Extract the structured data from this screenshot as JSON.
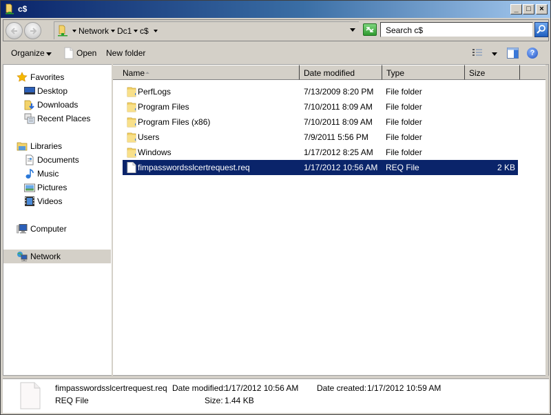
{
  "window": {
    "title": "c$",
    "controls": {
      "minimize": "_",
      "maximize": "□",
      "close": "×"
    }
  },
  "nav": {
    "back_icon": "arrow-left-icon",
    "forward_icon": "arrow-right-icon",
    "breadcrumb": [
      "Network",
      "Dc1",
      "c$"
    ],
    "search_placeholder": "Search c$"
  },
  "toolbar": {
    "organize_label": "Organize",
    "open_label": "Open",
    "new_folder_label": "New folder"
  },
  "sidebar": {
    "groups": [
      {
        "label": "Favorites",
        "icon": "star-icon",
        "items": [
          {
            "label": "Desktop",
            "icon": "desktop-icon"
          },
          {
            "label": "Downloads",
            "icon": "downloads-icon"
          },
          {
            "label": "Recent Places",
            "icon": "recent-places-icon"
          }
        ]
      },
      {
        "label": "Libraries",
        "icon": "libraries-icon",
        "items": [
          {
            "label": "Documents",
            "icon": "documents-icon"
          },
          {
            "label": "Music",
            "icon": "music-icon"
          },
          {
            "label": "Pictures",
            "icon": "pictures-icon"
          },
          {
            "label": "Videos",
            "icon": "videos-icon"
          }
        ]
      },
      {
        "label": "Computer",
        "icon": "computer-icon",
        "items": []
      },
      {
        "label": "Network",
        "icon": "network-icon",
        "items": [],
        "selected": true
      }
    ]
  },
  "filelist": {
    "columns": [
      "Name",
      "Date modified",
      "Type",
      "Size"
    ],
    "rows": [
      {
        "name": "PerfLogs",
        "date": "7/13/2009 8:20 PM",
        "type": "File folder",
        "size": "",
        "icon": "folder-icon"
      },
      {
        "name": "Program Files",
        "date": "7/10/2011 8:09 AM",
        "type": "File folder",
        "size": "",
        "icon": "folder-icon"
      },
      {
        "name": "Program Files (x86)",
        "date": "7/10/2011 8:09 AM",
        "type": "File folder",
        "size": "",
        "icon": "folder-icon"
      },
      {
        "name": "Users",
        "date": "7/9/2011 5:56 PM",
        "type": "File folder",
        "size": "",
        "icon": "folder-icon"
      },
      {
        "name": "Windows",
        "date": "1/17/2012 8:25 AM",
        "type": "File folder",
        "size": "",
        "icon": "folder-icon"
      },
      {
        "name": "fimpasswordsslcertrequest.req",
        "date": "1/17/2012 10:56 AM",
        "type": "REQ File",
        "size": "2 KB",
        "icon": "file-icon",
        "selected": true
      }
    ]
  },
  "details": {
    "filename": "fimpasswordsslcertrequest.req",
    "type": "REQ File",
    "date_modified_label": "Date modified:",
    "date_modified": "1/17/2012 10:56 AM",
    "size_label": "Size:",
    "size": "1.44 KB",
    "date_created_label": "Date created:",
    "date_created": "1/17/2012 10:59 AM"
  },
  "colors": {
    "selection": "#0a246a",
    "chrome": "#d4d0c8",
    "title_gradient_start": "#0a246a",
    "title_gradient_end": "#a6caf0"
  }
}
